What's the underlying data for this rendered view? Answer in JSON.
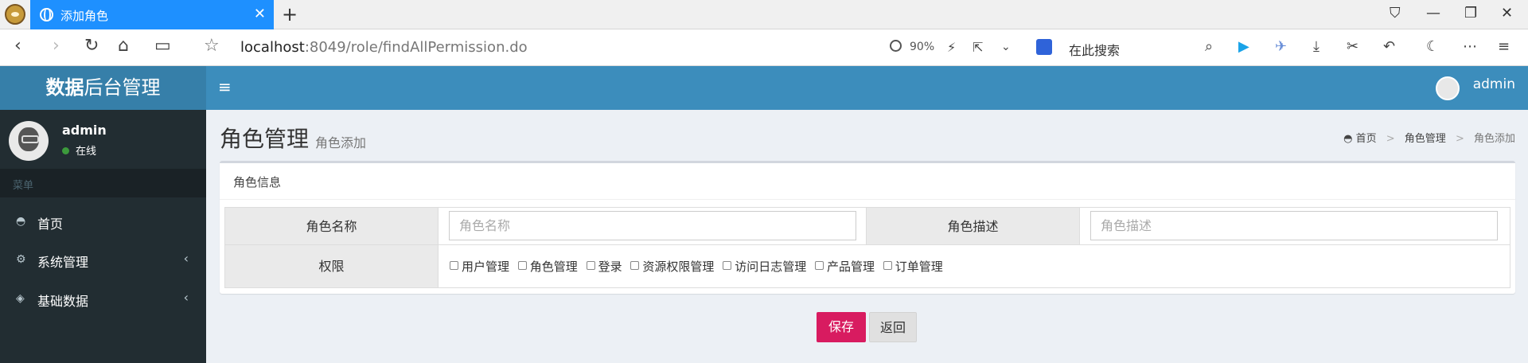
{
  "browser": {
    "tab_title": "添加角色",
    "url_host": "localhost",
    "url_rest": ":8049/role/findAllPermission.do",
    "zoom": "90%",
    "search_placeholder": "在此搜索"
  },
  "header": {
    "logo_bold": "数据",
    "logo_rest": "后台管理",
    "username": "admin"
  },
  "sidebar": {
    "username": "admin",
    "status": "在线",
    "menu_header": "菜单",
    "items": [
      {
        "label": "首页",
        "icon": "dashboard-icon"
      },
      {
        "label": "系统管理",
        "icon": "cogs-icon"
      },
      {
        "label": "基础数据",
        "icon": "cube-icon"
      }
    ]
  },
  "page": {
    "title": "角色管理",
    "subtitle": "角色添加",
    "breadcrumb": [
      "首页",
      "角色管理",
      "角色添加"
    ]
  },
  "form": {
    "box_title": "角色信息",
    "role_name_label": "角色名称",
    "role_name_placeholder": "角色名称",
    "role_desc_label": "角色描述",
    "role_desc_placeholder": "角色描述",
    "permission_label": "权限",
    "permissions": [
      "用户管理",
      "角色管理",
      "登录",
      "资源权限管理",
      "访问日志管理",
      "产品管理",
      "订单管理"
    ]
  },
  "actions": {
    "save": "保存",
    "back": "返回"
  }
}
